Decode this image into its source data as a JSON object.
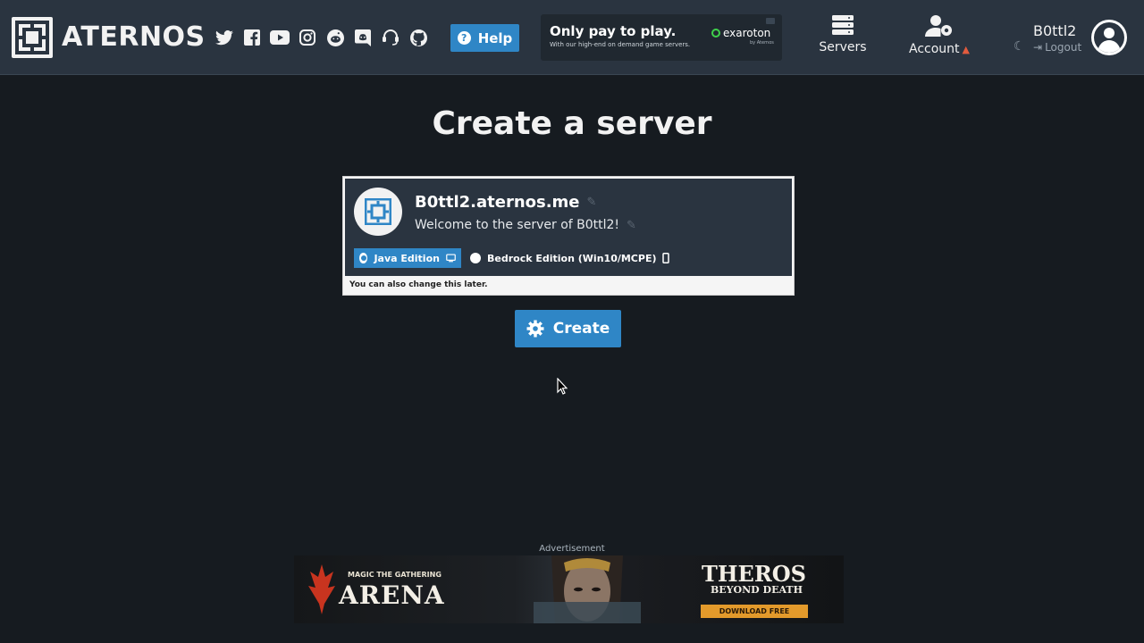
{
  "navbar": {
    "brand": "ATERNOS",
    "socials": [
      {
        "icon": "twitter-icon"
      },
      {
        "icon": "facebook-icon"
      },
      {
        "icon": "youtube-icon"
      },
      {
        "icon": "instagram-icon"
      },
      {
        "icon": "reddit-icon"
      },
      {
        "icon": "discord-icon"
      },
      {
        "icon": "support-headset-icon"
      },
      {
        "icon": "github-icon"
      }
    ],
    "help_label": "Help",
    "promo": {
      "title": "Only pay to play.",
      "subtitle": "With our high-end on demand game servers.",
      "brand": "exaroton",
      "by": "by Aternos"
    },
    "servers_label": "Servers",
    "account_label": "Account",
    "user_name": "B0ttl2",
    "logout_label": "Logout"
  },
  "main": {
    "title": "Create a server",
    "server": {
      "address": "B0ttl2.aternos.me",
      "motd": "Welcome to the server of B0ttl2!",
      "editions": [
        {
          "label": "Java Edition",
          "selected": true,
          "icon": "desktop-icon"
        },
        {
          "label": "Bedrock Edition (Win10/MCPE)",
          "selected": false,
          "icon": "mobile-icon"
        }
      ],
      "note": "You can also change this later."
    },
    "create_label": "Create"
  },
  "ad": {
    "label": "Advertisement",
    "mtg_line": "MAGIC THE GATHERING",
    "arena": "ARENA",
    "theros": "THEROS",
    "beyond_death": "BEYOND DEATH",
    "cta": "DOWNLOAD FREE"
  },
  "colors": {
    "background": "#161b20",
    "navbar": "#2a3440",
    "accent": "#2f86c6",
    "warning": "#e25b3e"
  }
}
